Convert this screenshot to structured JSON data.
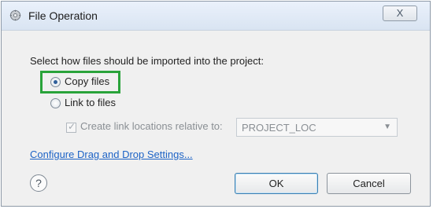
{
  "window": {
    "title": "File Operation",
    "close_glyph": "X",
    "icon": "gear-icon"
  },
  "dialog": {
    "prompt": "Select how files should be imported into the project:",
    "options": [
      {
        "label": "Copy files",
        "selected": true
      },
      {
        "label": "Link to files",
        "selected": false
      }
    ],
    "relative_checkbox": {
      "label": "Create link locations relative to:",
      "checked": true,
      "enabled": false
    },
    "relative_combo": {
      "value": "PROJECT_LOC",
      "enabled": false
    },
    "settings_link": "Configure Drag and Drop Settings...",
    "help_glyph": "?",
    "buttons": {
      "ok": "OK",
      "cancel": "Cancel"
    }
  },
  "colors": {
    "highlight": "#29a33a",
    "link": "#1d63c6",
    "accent": "#2f5f9a"
  }
}
